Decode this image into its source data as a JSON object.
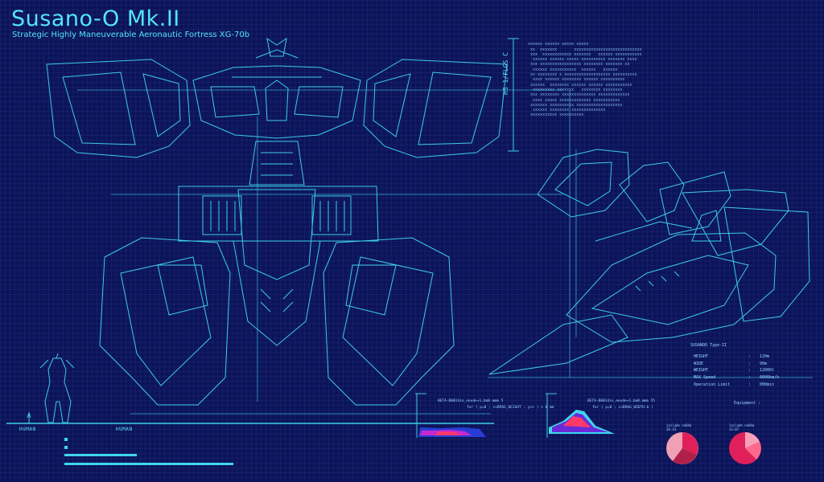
{
  "header": {
    "title": "Susano-O Mk.II",
    "subtitle": "Strategic Highly Maneuverable Aeronautic Fortress XG-70b"
  },
  "vertical_label": "HS 1/FLGS C",
  "scale_labels": {
    "human_left": "HUMAN",
    "human_right": "HUMAN"
  },
  "specs": {
    "name": "SUSANOO Type-II",
    "rows": [
      {
        "key": "HEIGHT",
        "value": "120m"
      },
      {
        "key": "WIDE",
        "value": "90m"
      },
      {
        "key": "WEIGHT",
        "value": "12000t"
      },
      {
        "key": "MAX Speed",
        "value": "0000km/h"
      },
      {
        "key": "Operation Limit",
        "value": "000min"
      }
    ],
    "equipment_label": "Equipment"
  },
  "plots": [
    {
      "title": "BETA-B0014in_eeude+1.bm8.mmm 5",
      "subtitle": "for ( p=0 ; c<DRAG_HEIGHT ; y++ ) < 0 mm"
    },
    {
      "title": "BETA-B0014in_eeude+1.bm8.mmm 55",
      "subtitle": "for ( p=0 ; c<DRAG_WIDTH-b )"
    }
  ],
  "pies": [
    {
      "label": "include ne04a",
      "value": "28.33"
    },
    {
      "label": "include ne04a",
      "value": "13.07"
    }
  ],
  "colors": {
    "background": "#0c1459",
    "line": "#3fd6ee",
    "accent": "#e0205a"
  }
}
